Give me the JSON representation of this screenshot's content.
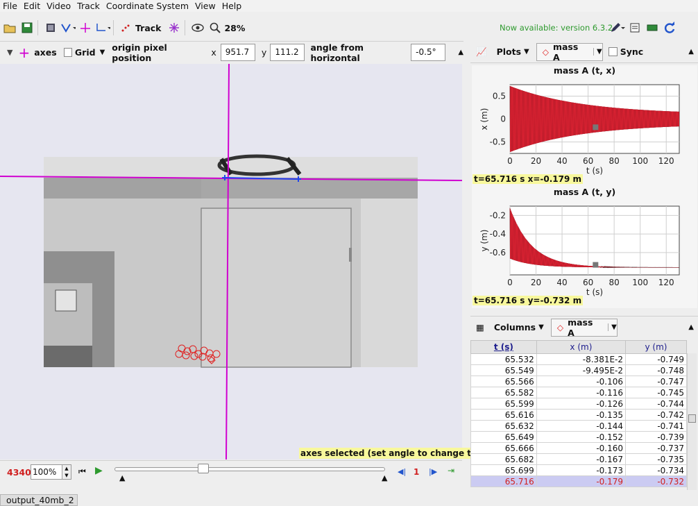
{
  "menu": [
    "File",
    "Edit",
    "Video",
    "Track",
    "Coordinate System",
    "View",
    "Help"
  ],
  "toolbar": {
    "track_label": "Track",
    "zoom": "28%",
    "update_notice": "Now available: version 6.3.2"
  },
  "axes_bar": {
    "axes_label": "axes",
    "grid_label": "Grid",
    "origin_label": "origin pixel position",
    "x_label": "x",
    "x_value": "951.7",
    "y_label": "y",
    "y_value": "111.2",
    "angle_label": "angle from horizontal",
    "angle_value": "-0.5°"
  },
  "video": {
    "status_tip": "axes selected (set angle to change tilt)"
  },
  "player": {
    "frame": "4340",
    "zoom": "100%",
    "step": "1"
  },
  "bottom_tab": "output_40mb_2",
  "plots": {
    "plots_label": "Plots",
    "track_name": "mass A",
    "sync_label": "Sync",
    "plot1": {
      "title": "mass A (t, x)",
      "ylabel": "x (m)",
      "xlabel": "t (s)",
      "readout": "t=65.716 s  x=-0.179 m"
    },
    "plot2": {
      "title": "mass A (t, y)",
      "ylabel": "y (m)",
      "xlabel": "t (s)",
      "readout": "t=65.716 s  y=-0.732 m"
    }
  },
  "chart_data": [
    {
      "type": "line",
      "title": "mass A (t, x)",
      "xlabel": "t (s)",
      "ylabel": "x (m)",
      "xlim": [
        0,
        130
      ],
      "ylim": [
        -0.75,
        0.75
      ],
      "x_ticks": [
        0,
        20,
        40,
        60,
        80,
        100,
        120
      ],
      "y_ticks": [
        0.5,
        0,
        -0.5
      ],
      "series": [
        {
          "envelope_start": 0.72,
          "envelope_end": 0.1,
          "decay": 0.018,
          "color": "#dd2233"
        }
      ]
    },
    {
      "type": "line",
      "title": "mass A (t, y)",
      "xlabel": "t (s)",
      "ylabel": "y (m)",
      "xlim": [
        0,
        130
      ],
      "ylim": [
        -0.84,
        -0.1
      ],
      "x_ticks": [
        0,
        20,
        40,
        60,
        80,
        100,
        120
      ],
      "y_ticks": [
        -0.2,
        -0.4,
        -0.6
      ],
      "series": [
        {
          "baseline": -0.76,
          "start": -0.12,
          "decay": 0.06,
          "color": "#dd2233"
        }
      ]
    }
  ],
  "table": {
    "columns_label": "Columns",
    "track_name": "mass A",
    "headers": [
      "t (s)",
      "x (m)",
      "y (m)"
    ],
    "rows": [
      [
        "65.532",
        "-8.381E-2",
        "-0.749"
      ],
      [
        "65.549",
        "-9.495E-2",
        "-0.748"
      ],
      [
        "65.566",
        "-0.106",
        "-0.747"
      ],
      [
        "65.582",
        "-0.116",
        "-0.745"
      ],
      [
        "65.599",
        "-0.126",
        "-0.744"
      ],
      [
        "65.616",
        "-0.135",
        "-0.742"
      ],
      [
        "65.632",
        "-0.144",
        "-0.741"
      ],
      [
        "65.649",
        "-0.152",
        "-0.739"
      ],
      [
        "65.666",
        "-0.160",
        "-0.737"
      ],
      [
        "65.682",
        "-0.167",
        "-0.735"
      ],
      [
        "65.699",
        "-0.173",
        "-0.734"
      ],
      [
        "65.716",
        "-0.179",
        "-0.732"
      ]
    ],
    "selected_row": 11
  },
  "colors": {
    "axis_magenta": "#d000d0",
    "track_red": "#e02020",
    "tip_yellow": "#f8f89c",
    "green_notice": "#2e9a2e"
  }
}
